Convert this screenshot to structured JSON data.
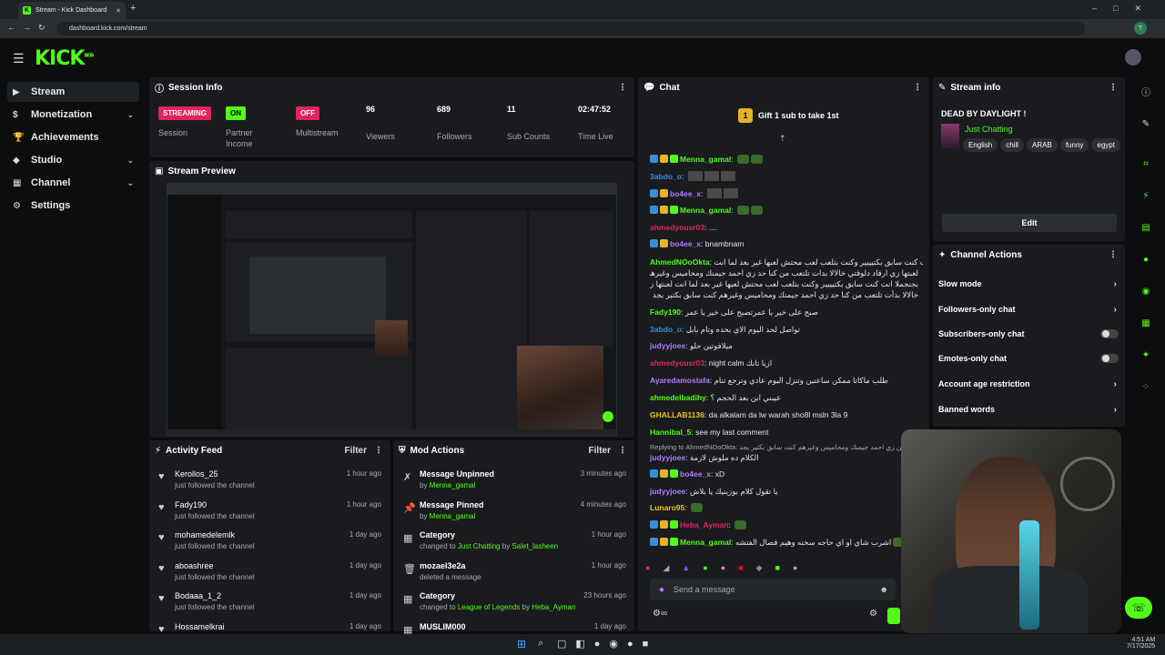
{
  "browser": {
    "tab_title": "Stream - Kick Dashboard",
    "url": "dashboard.kick.com/stream",
    "profile_initial": "T"
  },
  "app": {
    "logo": "KICK",
    "logo_sup": "BETA"
  },
  "sidebar": {
    "items": [
      {
        "label": "Stream",
        "icon": "video-icon"
      },
      {
        "label": "Monetization",
        "icon": "dollar-icon"
      },
      {
        "label": "Achievements",
        "icon": "trophy-icon"
      },
      {
        "label": "Studio",
        "icon": "palette-icon"
      },
      {
        "label": "Channel",
        "icon": "layout-icon"
      },
      {
        "label": "Settings",
        "icon": "gear-icon"
      }
    ]
  },
  "session": {
    "title": "Session Info",
    "stats": [
      {
        "value": "STREAMING",
        "label": "Session"
      },
      {
        "value": "ON",
        "label": "Partner\nIncome"
      },
      {
        "value": "OFF",
        "label": "Multistream"
      },
      {
        "value": "96",
        "label": "Viewers"
      },
      {
        "value": "689",
        "label": "Followers"
      },
      {
        "value": "11",
        "label": "Sub Counts"
      },
      {
        "value": "02:47:52",
        "label": "Time Live"
      }
    ]
  },
  "preview": {
    "title": "Stream Preview"
  },
  "activity": {
    "title": "Activity Feed",
    "filter": "Filter",
    "items": [
      {
        "name": "Kerollos_25",
        "sub": "just followed the channel",
        "time": "1 hour ago"
      },
      {
        "name": "Fady190",
        "sub": "just followed the channel",
        "time": "1 hour ago"
      },
      {
        "name": "mohamedelemlk",
        "sub": "just followed the channel",
        "time": "1 day ago"
      },
      {
        "name": "aboashree",
        "sub": "just followed the channel",
        "time": "1 day ago"
      },
      {
        "name": "Bodaaa_1_2",
        "sub": "just followed the channel",
        "time": "1 day ago"
      },
      {
        "name": "Hossamelkrai",
        "sub": "",
        "time": "1 day ago"
      }
    ]
  },
  "mod": {
    "title": "Mod Actions",
    "filter": "Filter",
    "items": [
      {
        "action": "Message Unpinned",
        "pre": "by ",
        "user": "Menna_gamal",
        "mid": "",
        "user2": "",
        "time": "3 minutes ago"
      },
      {
        "action": "Message Pinned",
        "pre": "by ",
        "user": "Menna_gamal",
        "mid": "",
        "user2": "",
        "time": "4 minutes ago"
      },
      {
        "action": "Category",
        "pre": "changed to ",
        "user": "Just Chatting",
        "mid": " by ",
        "user2": "Salet_lasheen",
        "time": "1 hour ago"
      },
      {
        "action": "mozael3e2a",
        "pre": "deleted a message",
        "user": "",
        "mid": "",
        "user2": "",
        "time": "1 hour ago"
      },
      {
        "action": "Category",
        "pre": "changed to ",
        "user": "League of Legends",
        "mid": " by ",
        "user2": "Heba_Ayman",
        "time": "23 hours ago"
      },
      {
        "action": "MUSLIM000",
        "pre": "",
        "user": "",
        "mid": "",
        "user2": "",
        "time": "1 day ago"
      }
    ]
  },
  "chat": {
    "title": "Chat",
    "gift": "Gift 1 sub to take 1st",
    "gift_count": "1",
    "placeholder": "Send a message",
    "messages": [
      {
        "user": "Menna_gamal",
        "color": "#53fc18",
        "text": "",
        "badges": 3,
        "emotes": 2
      },
      {
        "user": "3abdo_o",
        "color": "#3b8dd6",
        "text": "",
        "badges": 0,
        "emotes": 3
      },
      {
        "user": "bo4ee_x",
        "color": "#b57bff",
        "text": "",
        "badges": 2,
        "emotes": 2
      },
      {
        "user": "Menna_gamal",
        "color": "#53fc18",
        "text": "",
        "badges": 3,
        "emotes": 2
      },
      {
        "user": "ahmedyousr03",
        "color": "#e0245e",
        "text": "....",
        "badges": 0,
        "emotes": 0
      },
      {
        "user": "bo4ee_x",
        "color": "#b57bff",
        "text": "bnambnam",
        "badges": 2,
        "emotes": 0
      },
      {
        "user": "AhmedNOoOkta",
        "color": "#53fc18",
        "text": "قملا انت كنت سابق بكتيييير وكنت بتلعب لعب محتش لعبها غير بعد لما انت",
        "badges": 0,
        "emotes": 0
      },
      {
        "user": "",
        "color": "#fff",
        "text": "لعبتها زي ارقاد دلوقتي خالالا بدات تلتعب من كنا حد زي احمد جيمنك ومحاميس وغيرهم كنت سابق بكتير",
        "badges": 0,
        "emotes": 0
      },
      {
        "user": "",
        "color": "#fff",
        "text": "بجنجملا انت كنت سابق بكتيييير وكنت بتلعب لعب محتش لعبها غير بعد لما انت لعبتها زي ارقاد دلوقتي",
        "badges": 0,
        "emotes": 0
      },
      {
        "user": "",
        "color": "#fff",
        "text": "خالالا بدأت تلتعب من كنا حد زي احمد جيمنك ومحاميس وغيرهم كنت سابق بكتير بجد",
        "badges": 0,
        "emotes": 0
      },
      {
        "user": "Fady190",
        "color": "#53fc18",
        "text": "صبح على خير يا عمرتصبح على خير يا عمر",
        "badges": 0,
        "emotes": 0
      },
      {
        "user": "3abdo_o",
        "color": "#3b8dd6",
        "text": "تواصل لحد اليوم الاي بحده وتام بابل",
        "badges": 0,
        "emotes": 0
      },
      {
        "user": "judyyjoee",
        "color": "#b57bff",
        "text": "ميلافوتين حلو",
        "badges": 0,
        "emotes": 0
      },
      {
        "user": "ahmedyousr03",
        "color": "#e0245e",
        "text": "night calm ازيا تانك",
        "badges": 0,
        "emotes": 0
      },
      {
        "user": "Ayaredamostafa",
        "color": "#b57bff",
        "text": "طلب ماكاتا ممكن ساعتين وتنزل اليوم عادي وترجع تنام",
        "badges": 0,
        "emotes": 0
      },
      {
        "user": "ahmedelbadihy",
        "color": "#53fc18",
        "text": "عيبني ابن بعد الحجم ؟",
        "badges": 0,
        "emotes": 0
      },
      {
        "user": "GHALLAB1136",
        "color": "#f0c419",
        "text": "da alkalam da lw warah sho8l msln 3la 9",
        "badges": 0,
        "emotes": 0
      },
      {
        "user": "Hannibal_5",
        "color": "#53fc18",
        "text": "see my last comment",
        "badges": 0,
        "emotes": 0
      },
      {
        "user": "",
        "color": "#aaa",
        "text": "Replying to AhmedNOoOkta: بقن زي احمد جيمنك ومحاميس وغيرهم كنت سابق بكتير بجد",
        "badges": 0,
        "emotes": 0
      },
      {
        "user": "judyyjoee",
        "color": "#b57bff",
        "text": "الكلام ده ملوش لازمة",
        "badges": 0,
        "emotes": 0
      },
      {
        "user": "bo4ee_x",
        "color": "#b57bff",
        "text": "xD",
        "badges": 3,
        "emotes": 0
      },
      {
        "user": "judyyjoee",
        "color": "#b57bff",
        "text": "يا تقول كلام بوزينيك يا بلاش",
        "badges": 0,
        "emotes": 0
      },
      {
        "user": "Lunaro95",
        "color": "#f0c419",
        "text": "",
        "badges": 0,
        "emotes": 1
      },
      {
        "user": "Heba_Ayman",
        "color": "#e0245e",
        "text": "",
        "badges": 3,
        "emotes": 1
      },
      {
        "user": "Menna_gamal",
        "color": "#53fc18",
        "text": "اشرب شاي او اي حاجه سخنه وهيم فصال الفتشه",
        "badges": 3,
        "emotes": 1
      }
    ]
  },
  "stream_info": {
    "title": "Stream info",
    "stream_title": "DEAD BY DAYLIGHT !",
    "category": "Just Chatting",
    "tags": [
      "English",
      "chill",
      "ARAB",
      "funny",
      "egypt"
    ],
    "edit": "Edit"
  },
  "channel_actions": {
    "title": "Channel Actions",
    "items": [
      {
        "label": "Slow mode",
        "type": "chevron"
      },
      {
        "label": "Followers-only chat",
        "type": "chevron"
      },
      {
        "label": "Subscribers-only chat",
        "type": "toggle"
      },
      {
        "label": "Emotes-only chat",
        "type": "toggle"
      },
      {
        "label": "Account age restriction",
        "type": "chevron"
      },
      {
        "label": "Banned words",
        "type": "chevron"
      }
    ]
  },
  "taskbar": {
    "time": "4:51 AM",
    "date": "7/17/2025"
  },
  "colors": {
    "accent": "#53fc18",
    "panel": "#191b1f",
    "bg": "#0b0d0f",
    "streaming": "#e0245e"
  }
}
